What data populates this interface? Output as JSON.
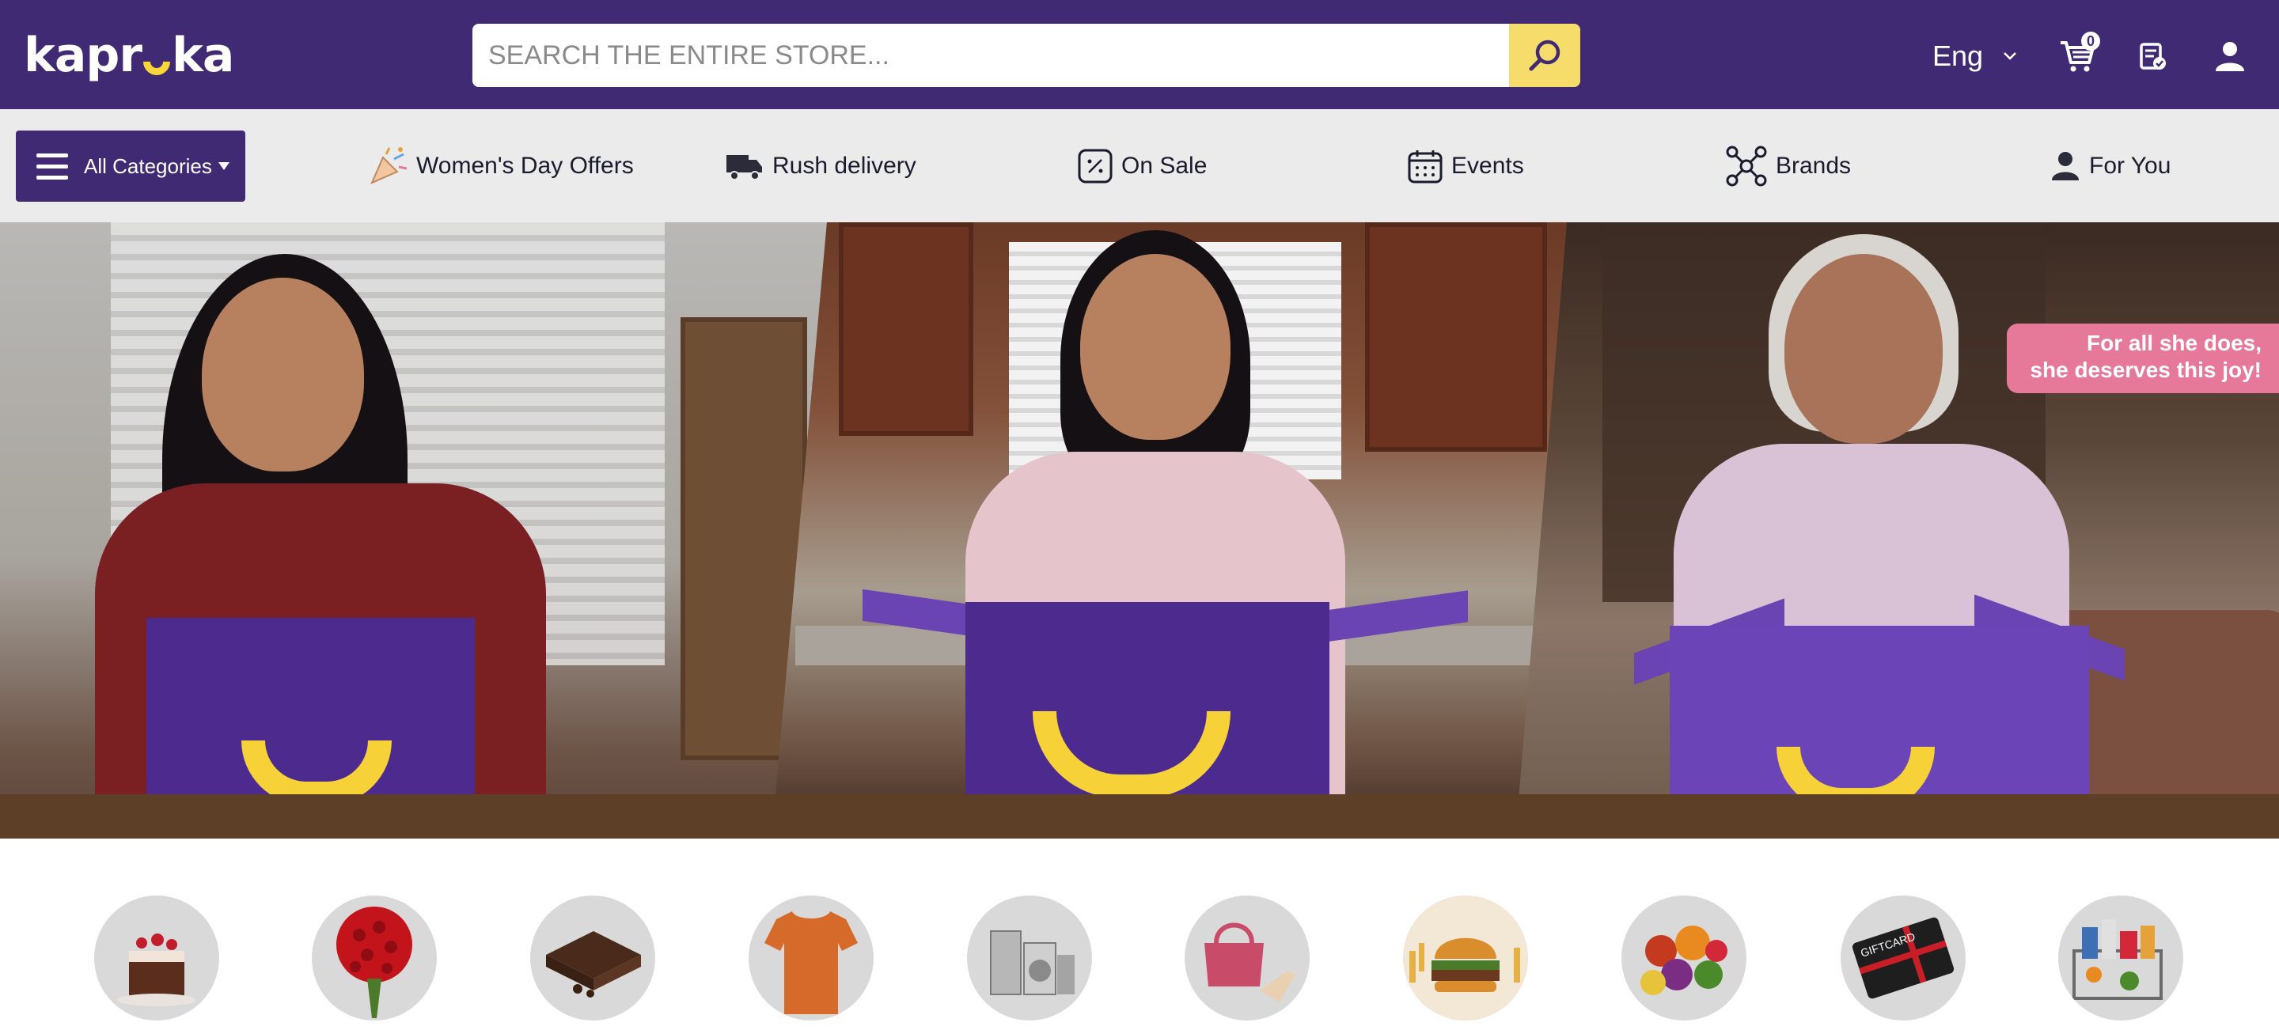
{
  "header": {
    "logo_text": "kapruka",
    "search": {
      "placeholder": "SEARCH THE ENTIRE STORE...",
      "value": ""
    },
    "language": "Eng",
    "cart_count": "0",
    "icons": [
      "search-icon",
      "chevron-down-icon",
      "cart-icon",
      "orders-icon",
      "user-icon"
    ]
  },
  "nav": {
    "all_categories_label": "All Categories",
    "items": [
      {
        "label": "Women's Day Offers",
        "icon": "party-popper-icon"
      },
      {
        "label": "Rush delivery",
        "icon": "truck-icon"
      },
      {
        "label": "On Sale",
        "icon": "percent-tag-icon"
      },
      {
        "label": "Events",
        "icon": "calendar-icon"
      },
      {
        "label": "Brands",
        "icon": "network-icon"
      },
      {
        "label": "For You",
        "icon": "person-icon"
      }
    ]
  },
  "banner": {
    "promo_line1": "For all she does,",
    "promo_line2": "she deserves this joy!"
  },
  "categories": [
    {
      "name": "cake",
      "color": "#5a2d1c"
    },
    {
      "name": "roses",
      "color": "#c3141c"
    },
    {
      "name": "chocolate",
      "color": "#4a2b1b"
    },
    {
      "name": "t-shirt",
      "color": "#d66a2b"
    },
    {
      "name": "appliances",
      "color": "#9a9a9a"
    },
    {
      "name": "handbag-and-shoes",
      "color": "#c84b6a"
    },
    {
      "name": "fast-food",
      "color": "#d98d2c"
    },
    {
      "name": "fruits",
      "color": "#c33a1e"
    },
    {
      "name": "gift-card",
      "color": "#1e1e1e"
    },
    {
      "name": "groceries",
      "color": "#3d6fb5"
    }
  ],
  "colors": {
    "brand_purple": "#3f2a73",
    "accent_yellow": "#f6dc6a",
    "nav_background": "#ebebeb",
    "promo_pink": "#e6799a"
  }
}
